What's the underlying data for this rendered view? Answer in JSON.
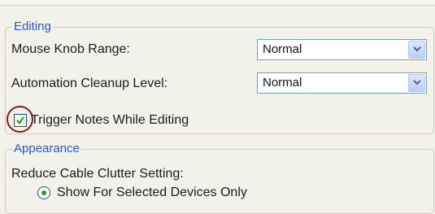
{
  "editing": {
    "group_label": "Editing",
    "mouse_knob_range": {
      "label": "Mouse Knob Range:",
      "value": "Normal"
    },
    "automation_cleanup_level": {
      "label": "Automation Cleanup Level:",
      "value": "Normal"
    },
    "trigger_notes": {
      "label": "Trigger Notes While Editing",
      "checked": true
    }
  },
  "appearance": {
    "group_label": "Appearance",
    "reduce_cable_clutter": {
      "label": "Reduce Cable Clutter Setting:"
    },
    "option_selected_devices": {
      "label": "Show For Selected Devices Only",
      "selected": true
    }
  },
  "colors": {
    "group_label": "#2a58d6",
    "highlight_ring": "#8a1a1a",
    "check": "#2a9a2a"
  },
  "icons": {
    "dropdown": "chevron-down-icon",
    "check": "checkmark-icon"
  }
}
